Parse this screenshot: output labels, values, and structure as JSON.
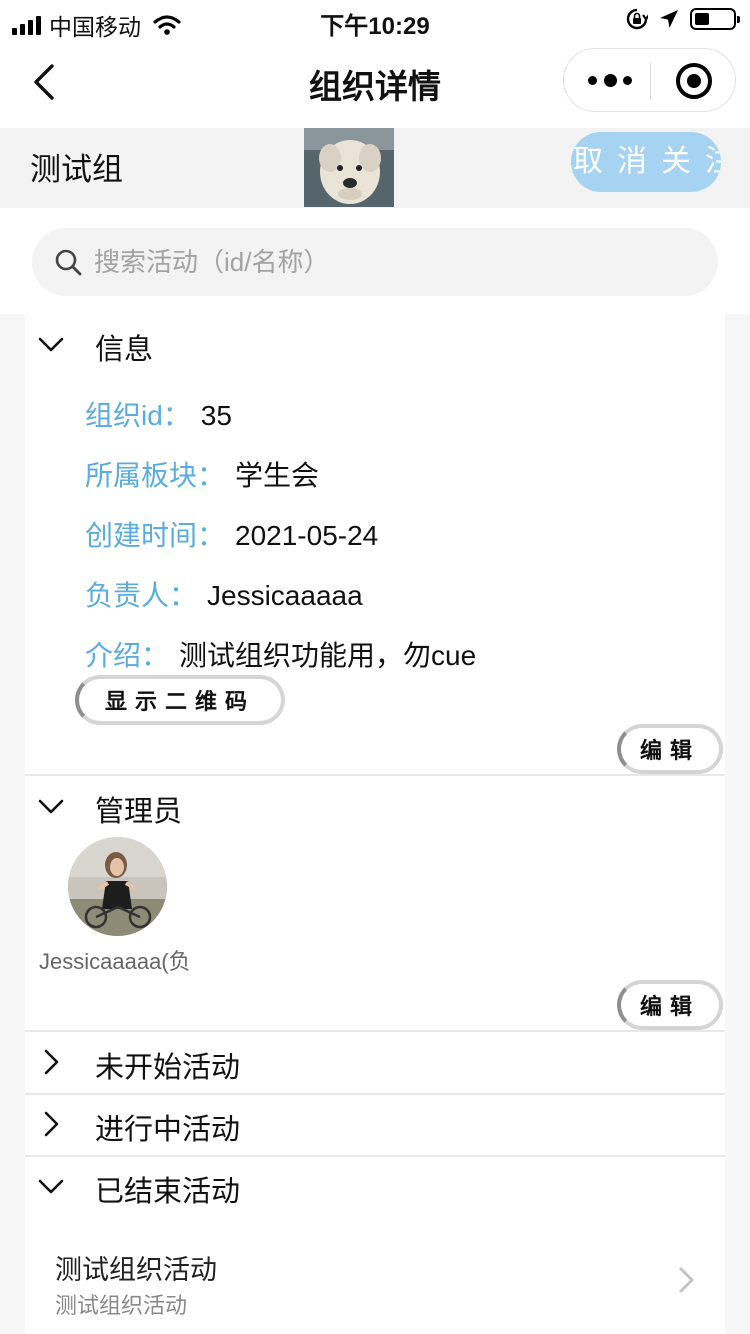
{
  "status_bar": {
    "carrier": "中国移动",
    "time": "下午10:29"
  },
  "nav": {
    "title": "组织详情"
  },
  "org": {
    "name": "测试组",
    "unfollow_label": "取消关注"
  },
  "search": {
    "placeholder": "搜索活动（id/名称）"
  },
  "info": {
    "section_label": "信息",
    "rows": [
      {
        "key": "组织id：",
        "value": "35"
      },
      {
        "key": "所属板块：",
        "value": "学生会"
      },
      {
        "key": "创建时间：",
        "value": "2021-05-24"
      },
      {
        "key": "负责人：",
        "value": "Jessicaaaaa"
      },
      {
        "key": "介绍：",
        "value": "测试组织功能用，勿cue"
      }
    ],
    "qr_button": "显示二维码",
    "edit_button": "编辑"
  },
  "admins": {
    "section_label": "管理员",
    "items": [
      {
        "name": "Jessicaaaaa(负"
      }
    ],
    "edit_button": "编辑"
  },
  "sections": {
    "not_started": "未开始活动",
    "in_progress": "进行中活动",
    "ended": "已结束活动"
  },
  "ended_activities": [
    {
      "title": "测试组织活动",
      "subtitle": "测试组织活动"
    }
  ]
}
